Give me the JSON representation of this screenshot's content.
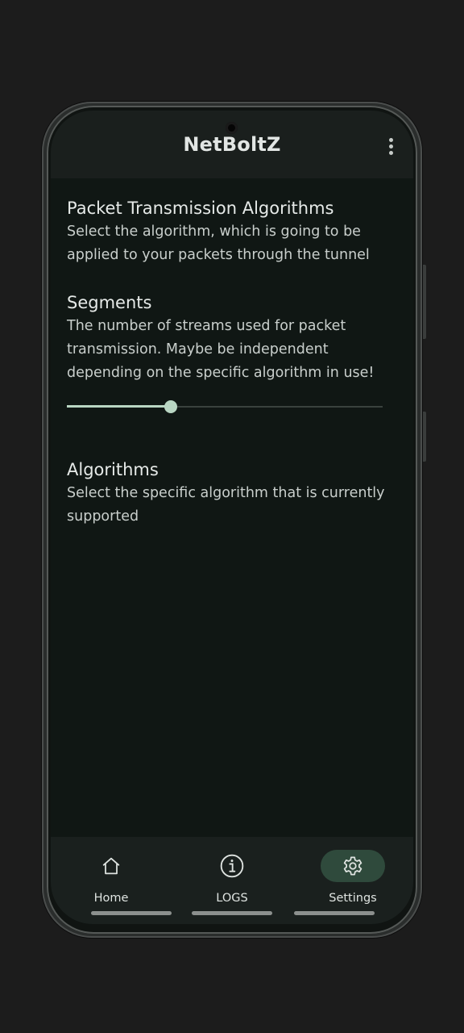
{
  "app": {
    "title": "NetBoltZ",
    "menu_icon": "more-vert-icon"
  },
  "sections": {
    "packet": {
      "title": "Packet Transmission Algorithms",
      "description": "Select the algorithm, which is going to be applied to your packets through the tunnel"
    },
    "segments": {
      "title": "Segments",
      "description": "The number of streams used for packet transmission. Maybe be independent depending on the specific algorithm in use!",
      "slider_value_fraction": 0.33
    },
    "algorithms": {
      "title": "Algorithms",
      "description": "Select the specific algorithm that is currently supported"
    }
  },
  "bottom_nav": {
    "items": [
      {
        "label": "Home",
        "icon": "home-icon",
        "active": false
      },
      {
        "label": "LOGS",
        "icon": "info-icon",
        "active": false
      },
      {
        "label": "Settings",
        "icon": "gear-icon",
        "active": true
      }
    ]
  },
  "colors": {
    "background": "#101714",
    "accent": "#b9d6c3",
    "active_pill": "#2f4a3c"
  }
}
